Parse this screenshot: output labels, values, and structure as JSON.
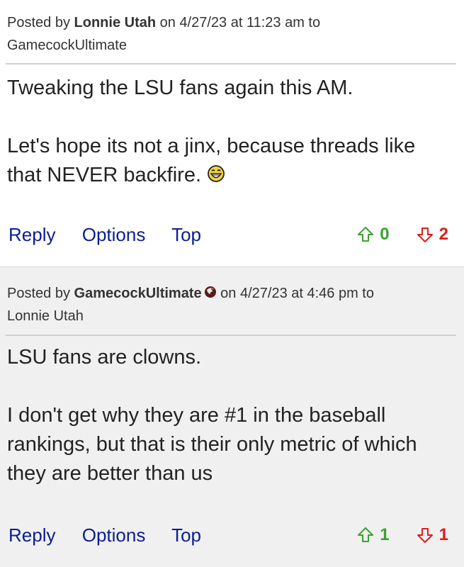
{
  "posts": [
    {
      "posted_by_prefix": "Posted by",
      "author": "Lonnie Utah",
      "date_text": "on 4/27/23 at 11:23 am to",
      "reply_to": "GamecockUltimate",
      "body_line1": "Tweaking the LSU fans again this AM.",
      "body_line2": "Let's hope its not a jinx, because threads like that NEVER backfire.",
      "emoji_icon": "laughing-emoji-icon",
      "actions": {
        "reply": "Reply",
        "options": "Options",
        "top": "Top"
      },
      "upvotes": "0",
      "downvotes": "2"
    },
    {
      "posted_by_prefix": "Posted by",
      "author": "GamecockUltimate",
      "author_badge_icon": "gamecock-team-icon",
      "date_text": "on 4/27/23 at 4:46 pm to",
      "reply_to": "Lonnie Utah",
      "body_line1": "LSU fans are clowns.",
      "body_line2": "I don't get why they are #1 in the baseball rankings, but that is their only metric of which they are better than us",
      "actions": {
        "reply": "Reply",
        "options": "Options",
        "top": "Top"
      },
      "upvotes": "1",
      "downvotes": "1"
    }
  ],
  "colors": {
    "link": "#0a1f8f",
    "upvote": "#3aa12e",
    "downvote": "#e01b1b",
    "alt_post_bg": "#f0f0f0"
  }
}
